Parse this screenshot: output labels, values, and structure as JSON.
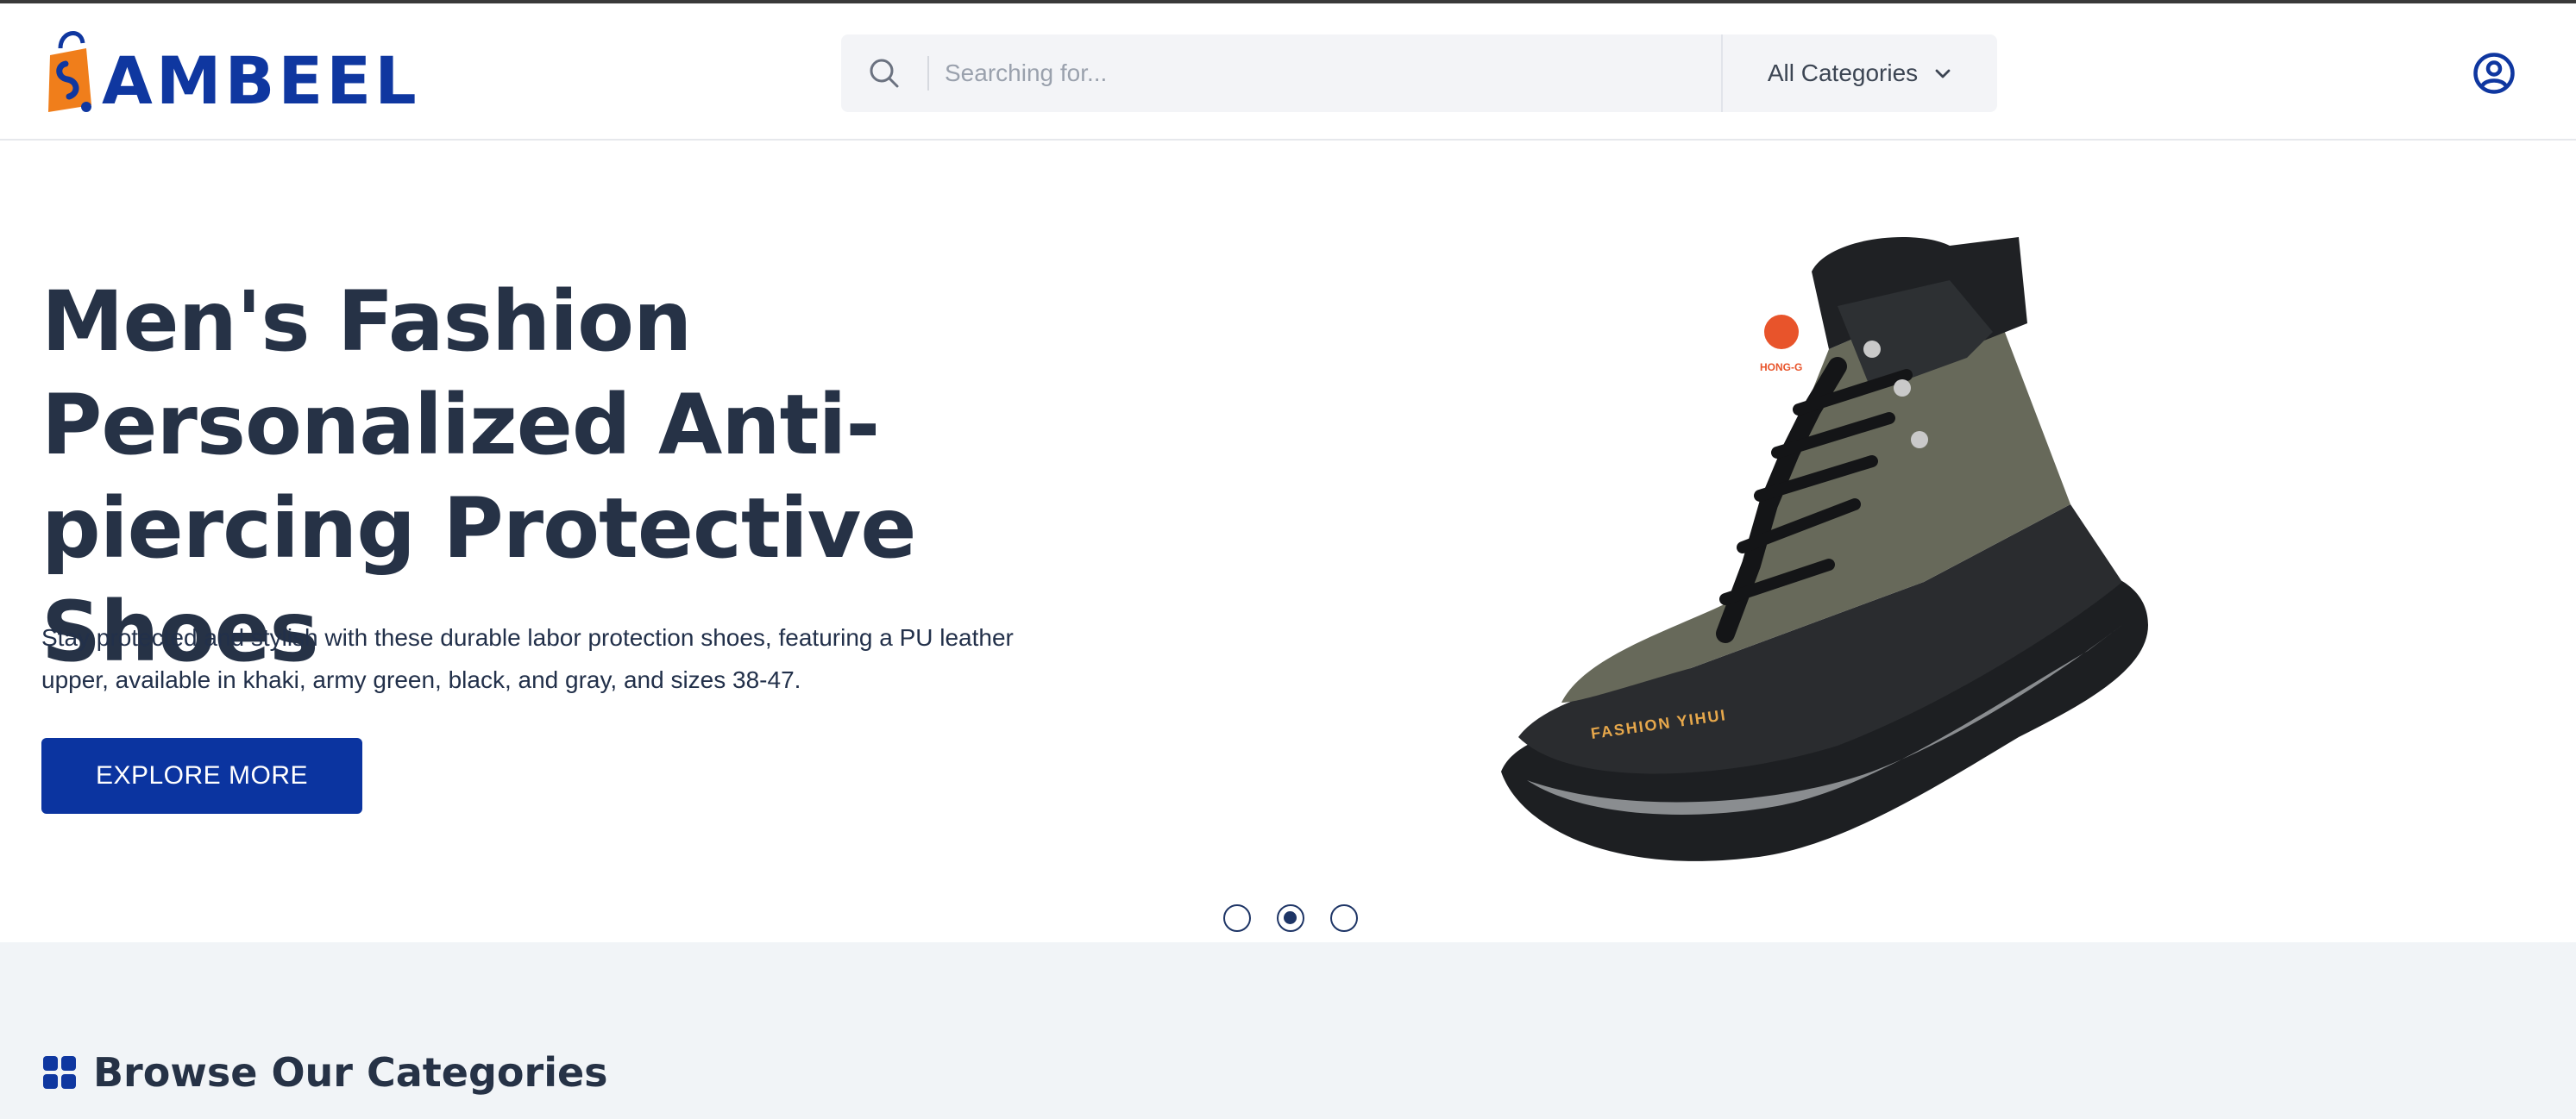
{
  "brand": {
    "name": "AMBEEL",
    "primary_color": "#0b34a0",
    "accent_color": "#f07e1b"
  },
  "header": {
    "search": {
      "icon": "search-icon",
      "placeholder": "Searching for...",
      "value": ""
    },
    "category_select": {
      "selected": "All Categories",
      "icon": "chevron-down-icon"
    },
    "account_icon": "user-circle-icon"
  },
  "hero": {
    "title": "Men's Fashion Personalized Anti-piercing Protective Shoes",
    "description": "Stay protected and stylish with these durable labor protection shoes, featuring a PU leather upper, available in khaki, army green, black, and gray, and sizes 38-47.",
    "button_label": "EXPLORE MORE",
    "image_subject": "hiking boot",
    "image_text": "FASHION YIHUI",
    "image_brand": "HONG-G",
    "carousel": {
      "slides": 3,
      "active_index": 1
    }
  },
  "categories": {
    "icon": "grid-icon",
    "title": "Browse Our Categories"
  }
}
